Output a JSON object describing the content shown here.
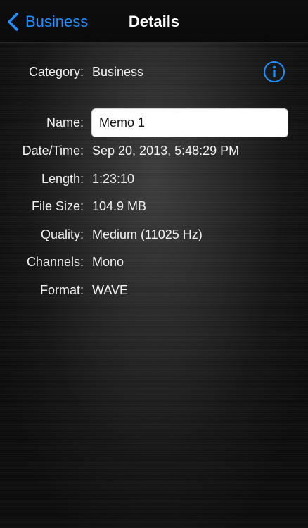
{
  "navbar": {
    "back_label": "Business",
    "title": "Details"
  },
  "details": {
    "category_label": "Category:",
    "category_value": "Business",
    "name_label": "Name:",
    "name_value": "Memo 1",
    "datetime_label": "Date/Time:",
    "datetime_value": "Sep 20, 2013, 5:48:29 PM",
    "length_label": "Length:",
    "length_value": "1:23:10",
    "filesize_label": "File Size:",
    "filesize_value": "104.9 MB",
    "quality_label": "Quality:",
    "quality_value": "Medium (11025 Hz)",
    "channels_label": "Channels:",
    "channels_value": "Mono",
    "format_label": "Format:",
    "format_value": "WAVE"
  },
  "icons": {
    "back": "chevron-left-icon",
    "info": "info-circle-icon"
  },
  "colors": {
    "accent": "#1e90ff",
    "text": "#ffffff",
    "background": "#111111",
    "field_background": "#ffffff"
  }
}
